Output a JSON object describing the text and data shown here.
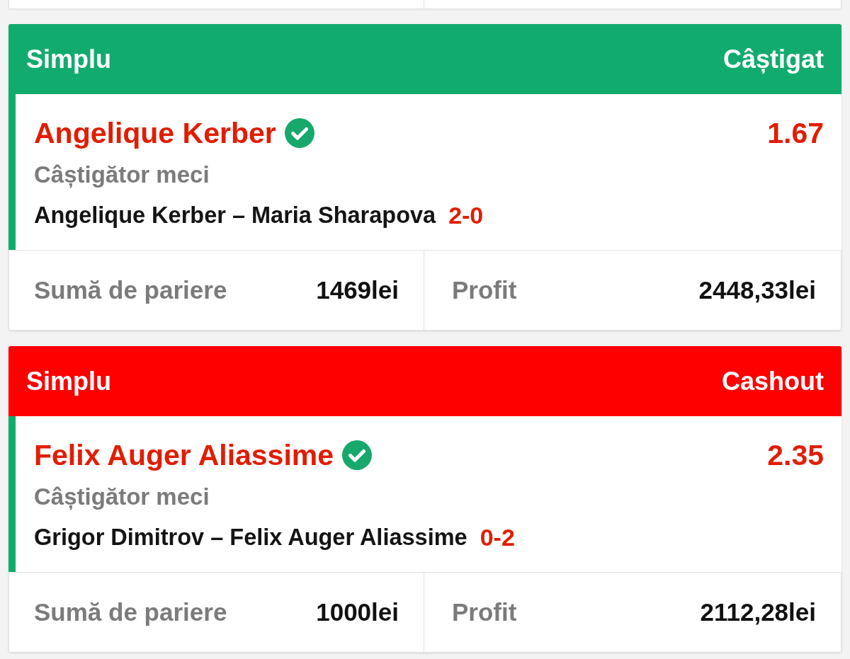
{
  "bets": [
    {
      "header": {
        "type": "Simplu",
        "status": "Câștigat",
        "color": "#12ab6e"
      },
      "selection": {
        "name": "Angelique Kerber",
        "won": true,
        "odds": "1.67",
        "market": "Câștigător meci",
        "match": "Angelique Kerber – Maria Sharapova",
        "score": "2-0"
      },
      "stake": {
        "label": "Sumă de pariere",
        "value": "1469lei"
      },
      "profit": {
        "label": "Profit",
        "value": "2448,33lei"
      }
    },
    {
      "header": {
        "type": "Simplu",
        "status": "Cashout",
        "color": "#fe0000"
      },
      "selection": {
        "name": "Felix Auger Aliassime",
        "won": true,
        "odds": "2.35",
        "market": "Câștigător meci",
        "match": "Grigor Dimitrov – Felix Auger Aliassime",
        "score": "0-2"
      },
      "stake": {
        "label": "Sumă de pariere",
        "value": "1000lei"
      },
      "profit": {
        "label": "Profit",
        "value": "2112,28lei"
      }
    }
  ]
}
